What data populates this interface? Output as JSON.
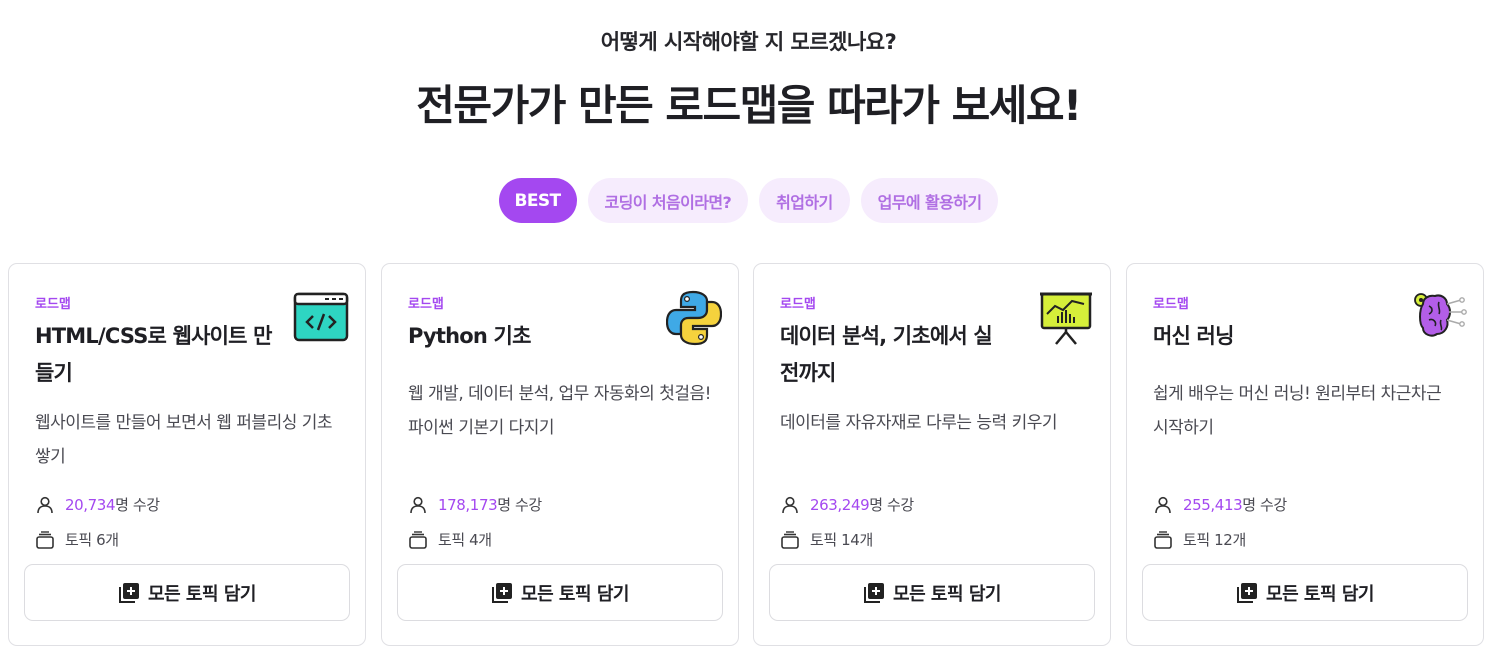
{
  "header": {
    "eyebrow": "어떻게 시작해야할 지 모르겠나요?",
    "headline": "전문가가 만든 로드맵을 따라가 보세요!"
  },
  "tabs": [
    {
      "label": "BEST",
      "active": true
    },
    {
      "label": "코딩이 처음이라면?",
      "active": false
    },
    {
      "label": "취업하기",
      "active": false
    },
    {
      "label": "업무에 활용하기",
      "active": false
    }
  ],
  "cards": [
    {
      "type": "로드맵",
      "title": "HTML/CSS로 웹사이트 만들기",
      "description": "웹사이트를 만들어 보면서 웹 퍼블리싱 기초 쌓기",
      "students": "20,734",
      "students_suffix": "명 수강",
      "topics": "토픽 6개",
      "button": "모든 토픽 담기",
      "icon": "code-window-icon"
    },
    {
      "type": "로드맵",
      "title": "Python 기초",
      "description": "웹 개발, 데이터 분석, 업무 자동화의 첫걸음! 파이썬 기본기 다지기",
      "students": "178,173",
      "students_suffix": "명 수강",
      "topics": "토픽 4개",
      "button": "모든 토픽 담기",
      "icon": "python-logo-icon"
    },
    {
      "type": "로드맵",
      "title": "데이터 분석, 기초에서 실전까지",
      "description": "데이터를 자유자재로 다루는 능력 키우기",
      "students": "263,249",
      "students_suffix": "명 수강",
      "topics": "토픽 14개",
      "button": "모든 토픽 담기",
      "icon": "presentation-chart-icon"
    },
    {
      "type": "로드맵",
      "title": "머신 러닝",
      "description": "쉽게 배우는 머신 러닝! 원리부터 차근차근 시작하기",
      "students": "255,413",
      "students_suffix": "명 수강",
      "topics": "토픽 12개",
      "button": "모든 토픽 담기",
      "icon": "ai-brain-icon"
    }
  ],
  "colors": {
    "accent": "#a448f0",
    "tab_bg": "#f6ecfd",
    "tab_text": "#b06fe3"
  }
}
